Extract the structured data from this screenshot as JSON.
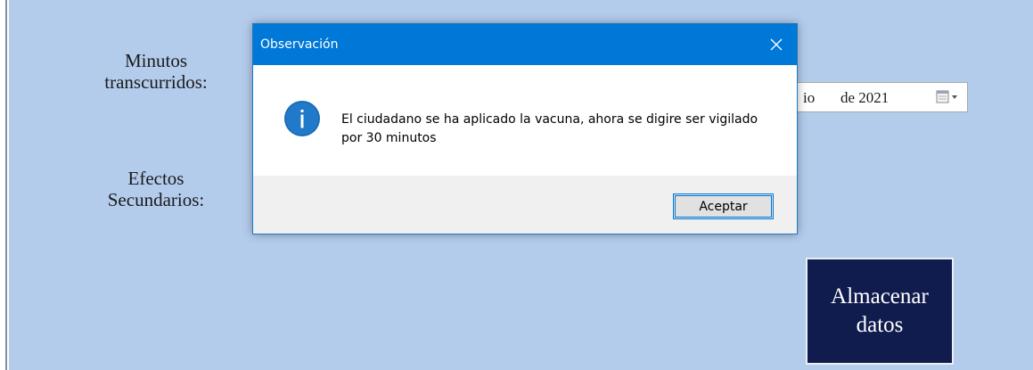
{
  "form": {
    "minutes_label_line1": "Minutos",
    "minutes_label_line2": "transcurridos:",
    "effects_label_line1": "Efectos",
    "effects_label_line2": "Secundarios:",
    "date_picker": {
      "month_fragment": "io",
      "year_text": "de 2021",
      "icon": "calendar-dropdown-icon"
    },
    "save_button": {
      "line1": "Almacenar",
      "line2": "datos"
    }
  },
  "dialog": {
    "title": "Observación",
    "close_glyph": "✕",
    "icon": "info-icon",
    "message": "El ciudadano se ha aplicado la vacuna, ahora se digire ser vigilado por 30 minutos",
    "ok_label": "Aceptar"
  },
  "colors": {
    "form_background": "#b4ccec",
    "title_bar": "#0078d7",
    "save_button_bg": "#111c4e",
    "info_icon": "#2179c9"
  }
}
